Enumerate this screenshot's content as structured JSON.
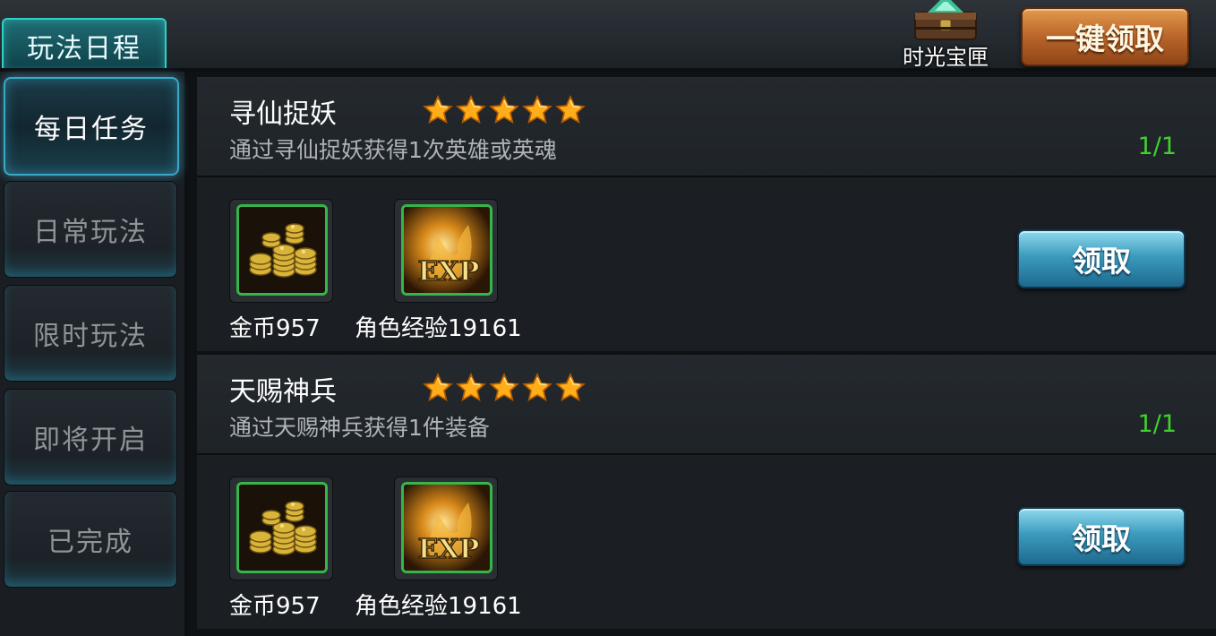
{
  "header": {
    "page_tab": "玩法日程",
    "chest_label": "时光宝匣",
    "claim_all_label": "一键领取"
  },
  "sidebar": {
    "items": [
      {
        "label": "每日任务",
        "active": true
      },
      {
        "label": "日常玩法",
        "active": false
      },
      {
        "label": "限时玩法",
        "active": false
      },
      {
        "label": "即将开启",
        "active": false
      },
      {
        "label": "已完成",
        "active": false
      }
    ]
  },
  "tasks": [
    {
      "title": "寻仙捉妖",
      "stars": 5,
      "description": "通过寻仙捉妖获得1次英雄或英魂",
      "progress": "1/1",
      "rewards": [
        {
          "icon": "gold-coins-icon",
          "label": "金币957"
        },
        {
          "icon": "exp-icon",
          "label": "角色经验19161"
        }
      ],
      "claim_label": "领取"
    },
    {
      "title": "天赐神兵",
      "stars": 5,
      "description": "通过天赐神兵获得1件装备",
      "progress": "1/1",
      "rewards": [
        {
          "icon": "gold-coins-icon",
          "label": "金币957"
        },
        {
          "icon": "exp-icon",
          "label": "角色经验19161"
        }
      ],
      "claim_label": "领取"
    }
  ],
  "colors": {
    "accent_teal": "#2fd0c8",
    "progress_green": "#3fd12c",
    "claim_blue": "#3c9bbd",
    "claim_all_orange": "#b9652a"
  }
}
